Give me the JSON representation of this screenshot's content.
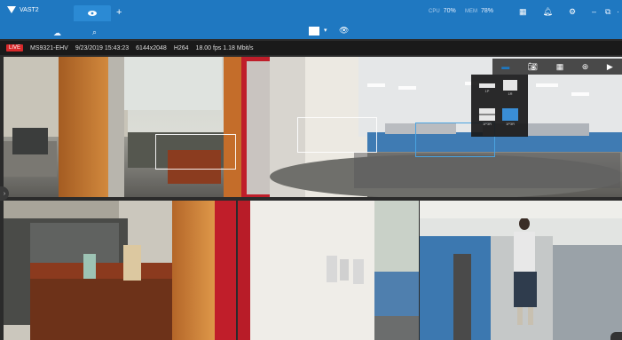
{
  "app": {
    "name": "VAST2"
  },
  "tabs": [
    {
      "label": "",
      "icon": "camera-icon",
      "active": true
    }
  ],
  "header": {
    "stats": [
      {
        "label": "CPU",
        "value": "70%"
      },
      {
        "label": "MEM",
        "value": "78%"
      }
    ]
  },
  "info": {
    "live": "LIVE",
    "camera": "MS9321-EHV",
    "datetime": "9/23/2019 15:43:23",
    "resolution": "6144x2048",
    "codec": "H264",
    "rate": "18.00 fps 1.18 Mbit/s"
  },
  "layout_options": [
    {
      "label": "1P"
    },
    {
      "label": "1R"
    },
    {
      "label": "1P3R"
    },
    {
      "label": "1P3R"
    }
  ],
  "colors": {
    "accent": "#1f78c1",
    "live": "#d9292b"
  }
}
